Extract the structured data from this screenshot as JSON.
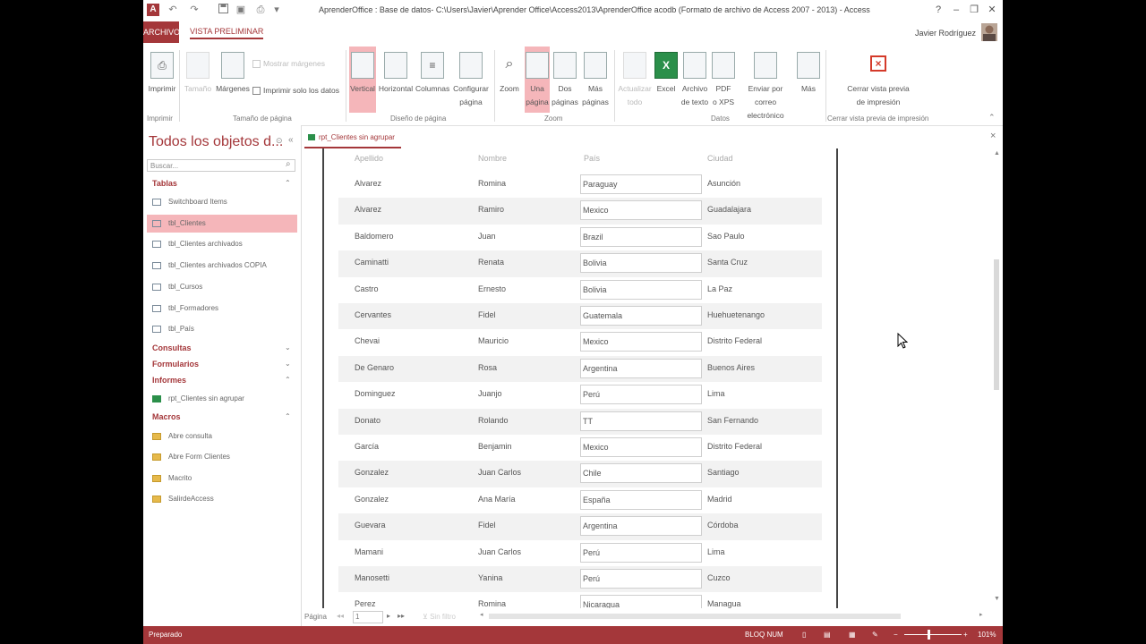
{
  "window": {
    "title": "AprenderOffice : Base de datos- C:\\Users\\Javier\\Aprender Office\\Access2013\\AprenderOffice acodb (Formato de archivo de Access 2007 - 2013) - Access",
    "app_icon": "A",
    "help": "?",
    "minimize": "–",
    "restore": "❐",
    "close": "✕"
  },
  "ribbon_tabs": {
    "file": "ARCHIVO",
    "active": "VISTA PRELIMINAR",
    "user": "Javier Rodríguez"
  },
  "ribbon": {
    "print": "Imprimir",
    "size": "Tamaño",
    "margins": "Márgenes",
    "show_margins": "Mostrar márgenes",
    "print_data_only": "Imprimir solo los datos",
    "portrait": "Vertical",
    "landscape": "Horizontal",
    "columns": "Columnas",
    "page_setup": "Configurar\npágina",
    "zoom": "Zoom",
    "one_page": "Una\npágina",
    "two_pages": "Dos\npáginas",
    "more_pages": "Más\npáginas",
    "refresh_all": "Actualizar\ntodo",
    "excel": "Excel",
    "text_file": "Archivo\nde texto",
    "pdf_xps": "PDF\no XPS",
    "email": "Enviar por correo\nelectrónico",
    "more": "Más",
    "close_preview": "Cerrar vista previa\nde impresión",
    "groups": {
      "print": "Imprimir",
      "page_size": "Tamaño de página",
      "page_layout": "Diseño de página",
      "zoom": "Zoom",
      "data": "Datos",
      "close_preview": "Cerrar vista previa de impresión"
    }
  },
  "nav": {
    "title": "Todos los objetos d...",
    "search_placeholder": "Buscar...",
    "sections": {
      "tables": "Tablas",
      "queries": "Consultas",
      "forms": "Formularios",
      "reports": "Informes",
      "macros": "Macros"
    },
    "tables": [
      "Switchboard Items",
      "tbl_Clientes",
      "tbl_Clientes archivados",
      "tbl_Clientes archivados COPIA",
      "tbl_Cursos",
      "tbl_Formadores",
      "tbl_País"
    ],
    "reports": [
      "rpt_Clientes sin agrupar"
    ],
    "macros": [
      "Abre consulta",
      "Abre Form Clientes",
      "Macrito",
      "SalirdeAccess"
    ]
  },
  "document": {
    "tab_label": "rpt_Clientes sin agrupar",
    "close": "×"
  },
  "report": {
    "headers": {
      "apellido": "Apellido",
      "nombre": "Nombre",
      "pais": "País",
      "ciudad": "Ciudad"
    },
    "rows": [
      {
        "apellido": "Alvarez",
        "nombre": "Romina",
        "pais": "Paraguay",
        "ciudad": "Asunción"
      },
      {
        "apellido": "Alvarez",
        "nombre": "Ramiro",
        "pais": "Mexico",
        "ciudad": "Guadalajara"
      },
      {
        "apellido": "Baldomero",
        "nombre": "Juan",
        "pais": "Brazil",
        "ciudad": "Sao Paulo"
      },
      {
        "apellido": "Caminatti",
        "nombre": "Renata",
        "pais": "Bolivia",
        "ciudad": "Santa Cruz"
      },
      {
        "apellido": "Castro",
        "nombre": "Ernesto",
        "pais": "Bolivia",
        "ciudad": "La Paz"
      },
      {
        "apellido": "Cervantes",
        "nombre": "Fidel",
        "pais": "Guatemala",
        "ciudad": "Huehuetenango"
      },
      {
        "apellido": "Chevai",
        "nombre": "Mauricio",
        "pais": "Mexico",
        "ciudad": "Distrito Federal"
      },
      {
        "apellido": "De Genaro",
        "nombre": "Rosa",
        "pais": "Argentina",
        "ciudad": "Buenos Aires"
      },
      {
        "apellido": "Dominguez",
        "nombre": "Juanjo",
        "pais": "Perú",
        "ciudad": "Lima"
      },
      {
        "apellido": "Donato",
        "nombre": "Rolando",
        "pais": "TT",
        "ciudad": "San Fernando"
      },
      {
        "apellido": "García",
        "nombre": "Benjamin",
        "pais": "Mexico",
        "ciudad": "Distrito Federal"
      },
      {
        "apellido": "Gonzalez",
        "nombre": "Juan Carlos",
        "pais": "Chile",
        "ciudad": "Santiago"
      },
      {
        "apellido": "Gonzalez",
        "nombre": "Ana María",
        "pais": "España",
        "ciudad": "Madrid"
      },
      {
        "apellido": "Guevara",
        "nombre": "Fidel",
        "pais": "Argentina",
        "ciudad": "Córdoba"
      },
      {
        "apellido": "Mamani",
        "nombre": "Juan Carlos",
        "pais": "Perú",
        "ciudad": "Lima"
      },
      {
        "apellido": "Manosetti",
        "nombre": "Yanina",
        "pais": "Perú",
        "ciudad": "Cuzco"
      },
      {
        "apellido": "Perez",
        "nombre": "Romina",
        "pais": "Nicaragua",
        "ciudad": "Managua"
      }
    ]
  },
  "record_nav": {
    "label": "Página",
    "current": "1",
    "filter": "Sin filtro"
  },
  "status": {
    "left": "Preparado",
    "num_lock": "BLOQ NUM",
    "zoom": "101%"
  }
}
